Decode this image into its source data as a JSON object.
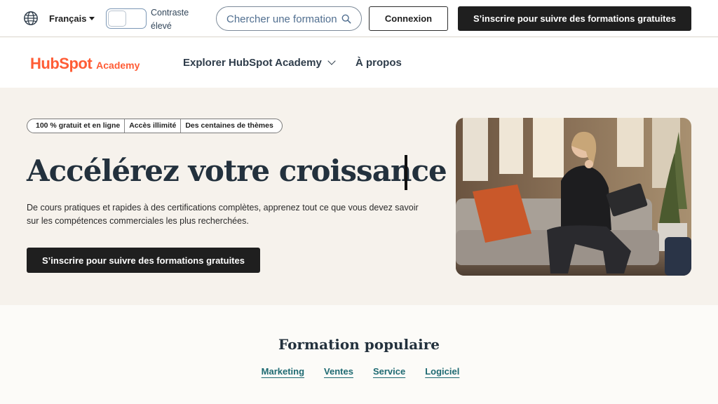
{
  "utility": {
    "language": "Français",
    "contrast_label": "Contraste élevé",
    "search_placeholder": "Chercher une formation",
    "login_label": "Connexion",
    "signup_label": "S’inscrire pour suivre des formations gratuites"
  },
  "nav": {
    "logo_brand": "HubSpot",
    "logo_academy": "Academy",
    "explore_label": "Explorer HubSpot Academy",
    "about_label": "À propos"
  },
  "hero": {
    "badges": [
      "100 % gratuit et en ligne",
      "Accès illimité",
      "Des centaines de thèmes"
    ],
    "title": "Accélérez votre croissance",
    "description": "De cours pratiques et rapides à des certifications complètes, apprenez tout ce que vous devez savoir sur les compétences commerciales les plus recherchées.",
    "cta_label": "S’inscrire pour suivre des formations gratuites"
  },
  "popular": {
    "title": "Formation populaire",
    "tabs": [
      "Marketing",
      "Ventes",
      "Service",
      "Logiciel"
    ]
  },
  "colors": {
    "brand_orange": "#ff5c35",
    "dark_button": "#1f1f1f",
    "hero_background": "#f6f2ec",
    "link_teal": "#1e6a72"
  }
}
